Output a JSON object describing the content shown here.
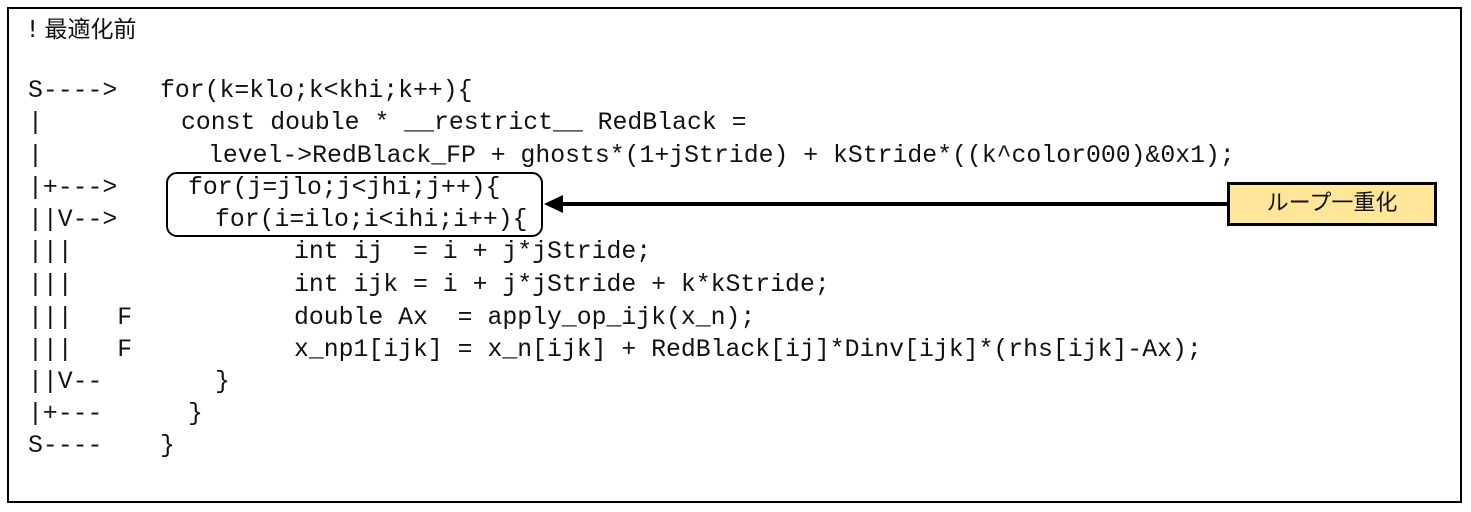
{
  "title": "! 最適化前",
  "lines": [
    {
      "prefix": "S---->",
      "code": "for(k=klo;k<khi;k++){"
    },
    {
      "prefix": "|",
      "code": "const double * __restrict__ RedBlack ="
    },
    {
      "prefix": "|",
      "code": "level->RedBlack_FP + ghosts*(1+jStride) + kStride*((k^color000)&0x1);"
    },
    {
      "prefix": "|+--->",
      "code": "for(j=jlo;j<jhi;j++){"
    },
    {
      "prefix": "||V-->",
      "code": "for(i=ilo;i<ihi;i++){"
    },
    {
      "prefix": "|||",
      "code": "int ij  = i + j*jStride;"
    },
    {
      "prefix": "|||",
      "code": "int ijk = i + j*jStride + k*kStride;"
    },
    {
      "prefix": "|||   F",
      "code": "double Ax  = apply_op_ijk(x_n);"
    },
    {
      "prefix": "|||   F",
      "code": "x_np1[ijk] = x_n[ijk] + RedBlack[ij]*Dinv[ijk]*(rhs[ijk]-Ax);"
    },
    {
      "prefix": "||V--",
      "code": "}"
    },
    {
      "prefix": "|+---",
      "code": "}"
    },
    {
      "prefix": "S----",
      "code": "}"
    }
  ],
  "callout": {
    "label": "ループ一重化",
    "fill": "#FFE699"
  }
}
